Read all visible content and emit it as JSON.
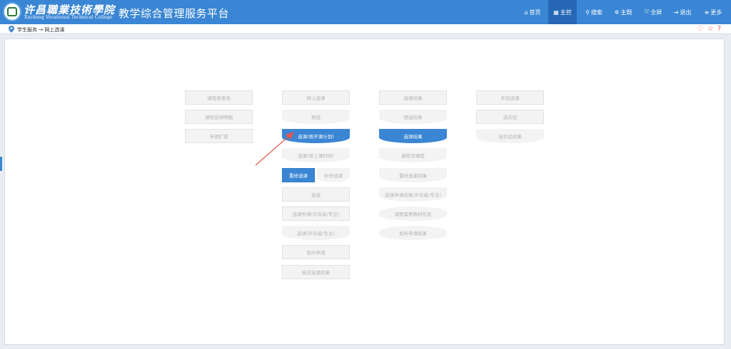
{
  "header": {
    "school_cn": "许昌職業技術學院",
    "school_en": "Xuchang   Vocational   Technical   College",
    "platform_title": "教学综合管理服务平台",
    "nav": [
      {
        "icon": "home-icon",
        "glyph": "⌂",
        "label": "首页"
      },
      {
        "icon": "windows-icon",
        "glyph": "▦",
        "label": "主控"
      },
      {
        "icon": "search-icon",
        "glyph": "⚲",
        "label": "搜索"
      },
      {
        "icon": "theme-icon",
        "glyph": "✲",
        "label": "主题"
      },
      {
        "icon": "fullscreen-icon",
        "glyph": "⤧",
        "label": "全屏"
      },
      {
        "icon": "logout-icon",
        "glyph": "⇥",
        "label": "退出"
      },
      {
        "icon": "menu-icon",
        "glyph": "≡",
        "label": "更多"
      }
    ]
  },
  "breadcrumb": {
    "text": "学生服务 → 网上选课"
  },
  "columns": {
    "col1": [
      "课程表查询",
      "课程安排明细",
      "申请扩容"
    ],
    "col2": [
      "网上选课",
      "预选",
      "选课(按开课计划)",
      "选课(按上课时间)",
      "重修选课",
      "补修选课",
      "退选",
      "选课申请(外年级/专业)",
      "选课(外年级/专业)",
      "免听申请",
      "核对选课结果"
    ],
    "col3": [
      "选课结果",
      "预选结果",
      "选课结果",
      "被取消课程",
      "重修选课结果",
      "选课申请结果(外年级/专业)",
      "调整需要教材信息",
      "免听申请结果"
    ],
    "col4": [
      "实验选课",
      "选实验",
      "选实验结果"
    ]
  },
  "colors": {
    "brand_blue": "#3a86d4",
    "arrow_red": "#e2574c"
  }
}
